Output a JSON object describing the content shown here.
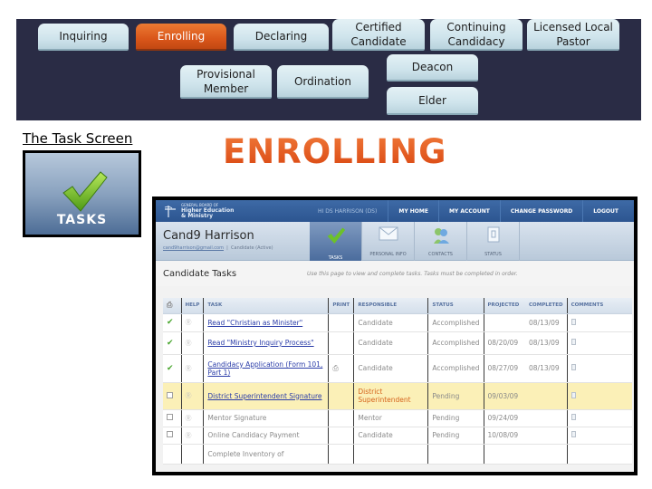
{
  "stages": {
    "row1": [
      {
        "label": "Inquiring",
        "active": false
      },
      {
        "label": "Enrolling",
        "active": true
      },
      {
        "label": "Declaring",
        "active": false
      },
      {
        "label": "Certified\nCandidate",
        "active": false
      },
      {
        "label": "Continuing\nCandidacy",
        "active": false
      },
      {
        "label": "Licensed Local\nPastor",
        "active": false
      }
    ],
    "row2": [
      {
        "label": "Provisional\nMember",
        "active": false
      },
      {
        "label": "Ordination",
        "active": false
      },
      {
        "label": "Deacon",
        "active": false
      },
      {
        "label": "Elder",
        "active": false
      }
    ]
  },
  "task_screen": {
    "caption": "The Task Screen",
    "icon": "checkmark-icon",
    "icon_label": "TASKS"
  },
  "heading": "ENROLLING",
  "colors": {
    "band": "#2a2c45",
    "active_stage": "#d9561a",
    "heading": "#e0511b",
    "app_blue": "#2c5590",
    "highlight_row": "#fbf0b7",
    "link": "#2a3ca8"
  },
  "app": {
    "org": {
      "small": "GENERAL BOARD OF",
      "line1": "Higher Education",
      "line2": "& Ministry"
    },
    "greeting": "HI DS HARRISON (DS)",
    "nav": [
      "MY HOME",
      "MY ACCOUNT",
      "CHANGE PASSWORD",
      "LOGOUT"
    ],
    "candidate_name": "Cand9 Harrison",
    "candidate_email": "cand9harrison@gmail.com",
    "candidate_status": "Candidate (Active)",
    "tabs": [
      {
        "label": "TASKS",
        "icon": "checkmark-icon",
        "active": true
      },
      {
        "label": "PERSONAL INFO",
        "icon": "envelope-icon",
        "active": false
      },
      {
        "label": "CONTACTS",
        "icon": "contacts-icon",
        "active": false
      },
      {
        "label": "STATUS",
        "icon": "document-icon",
        "active": false
      }
    ],
    "section_title": "Candidate Tasks",
    "section_hint": "Use this page to view and complete tasks. Tasks must be completed in order.",
    "table": {
      "columns": [
        "",
        "HELP",
        "TASK",
        "PRINT",
        "RESPONSIBLE",
        "STATUS",
        "PROJECTED",
        "COMPLETED",
        "COMMENTS"
      ],
      "rows": [
        {
          "done": true,
          "task": "Read \"Christian as Minister\"",
          "link": true,
          "print": false,
          "responsible": "Candidate",
          "status": "Accomplished",
          "projected": "",
          "completed": "08/13/09",
          "highlight": false
        },
        {
          "done": true,
          "task": "Read \"Ministry Inquiry Process\"",
          "link": true,
          "print": false,
          "responsible": "Candidate",
          "status": "Accomplished",
          "projected": "08/20/09",
          "completed": "08/13/09",
          "highlight": false
        },
        {
          "done": true,
          "task": "Candidacy Application (Form 101, Part 1)",
          "link": true,
          "print": true,
          "responsible": "Candidate",
          "status": "Accomplished",
          "projected": "08/27/09",
          "completed": "08/13/09",
          "highlight": false
        },
        {
          "done": false,
          "task": "District Superintendent Signature",
          "link": true,
          "print": false,
          "responsible": "District Superintendent",
          "status": "Pending",
          "projected": "09/03/09",
          "completed": "",
          "highlight": true
        },
        {
          "done": false,
          "task": "Mentor Signature",
          "link": false,
          "print": false,
          "responsible": "Mentor",
          "status": "Pending",
          "projected": "09/24/09",
          "completed": "",
          "highlight": false
        },
        {
          "done": false,
          "task": "Online Candidacy Payment",
          "link": false,
          "print": false,
          "responsible": "Candidate",
          "status": "Pending",
          "projected": "10/08/09",
          "completed": "",
          "highlight": false
        },
        {
          "done": null,
          "task": "Complete Inventory of",
          "link": false,
          "print": false,
          "responsible": "",
          "status": "",
          "projected": "",
          "completed": "",
          "highlight": false
        }
      ]
    }
  }
}
